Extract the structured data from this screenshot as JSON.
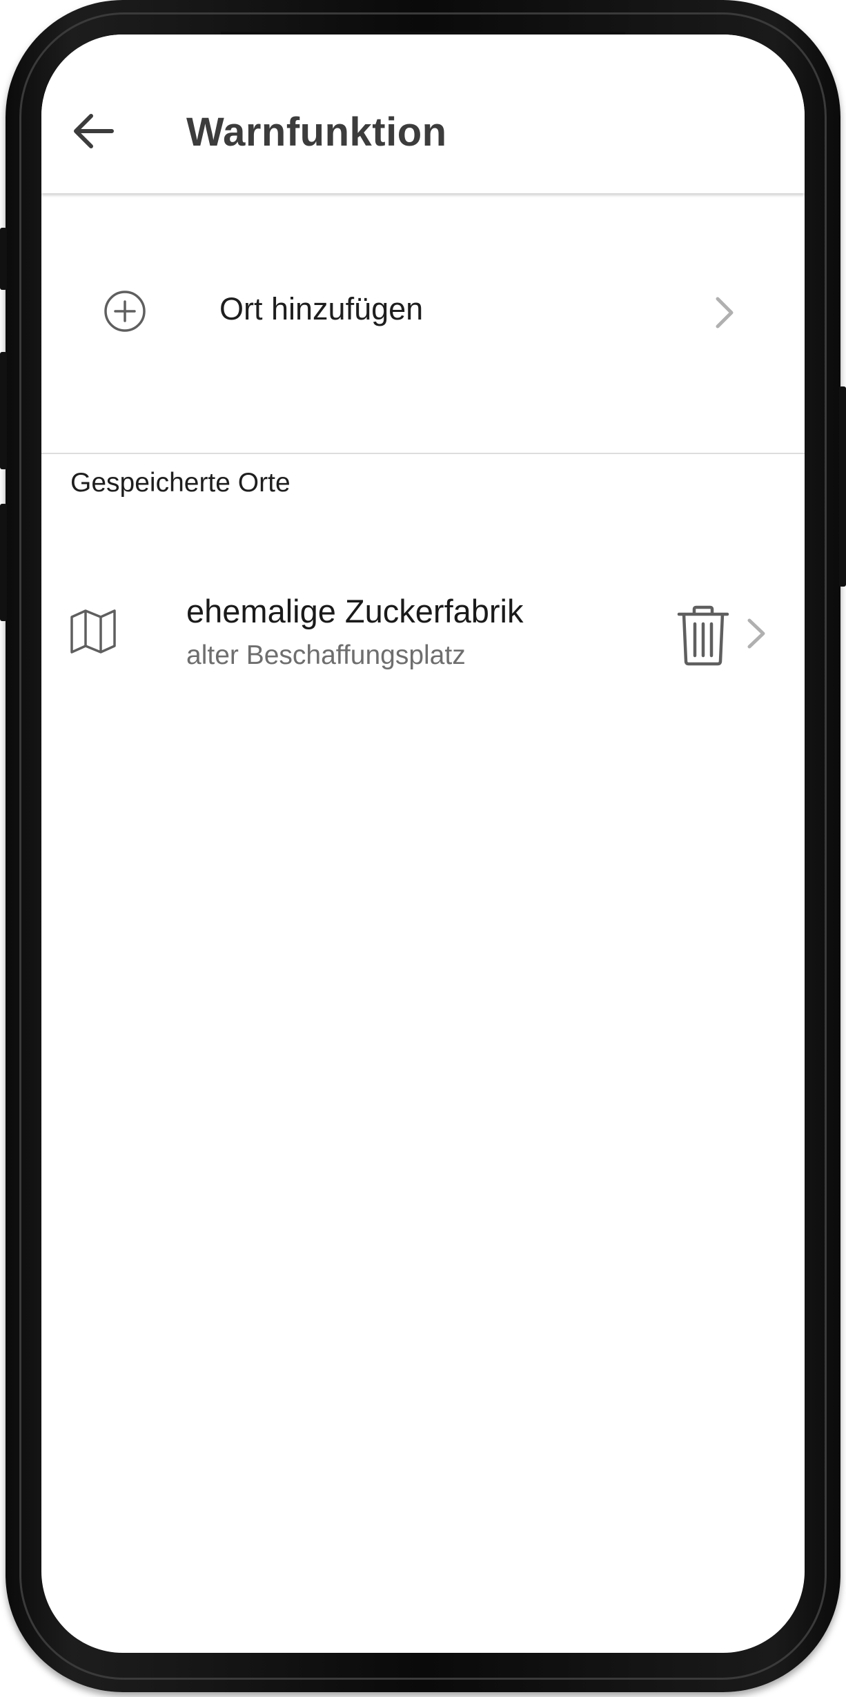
{
  "header": {
    "title": "Warnfunktion",
    "back_icon": "arrow-left-icon"
  },
  "add_place": {
    "label": "Ort hinzufügen",
    "icon": "plus-circle-icon",
    "chevron_icon": "chevron-right-icon"
  },
  "saved_places": {
    "section_title": "Gespeicherte Orte",
    "items": [
      {
        "title": "ehemalige Zuckerfabrik",
        "subtitle": "alter Beschaffungsplatz",
        "icon": "map-icon",
        "delete_icon": "trash-icon",
        "chevron_icon": "chevron-right-icon"
      }
    ]
  },
  "colors": {
    "title_text": "#3c3c3c",
    "primary_text": "#1a1a1a",
    "secondary_text": "#6e6e6e",
    "icon": "#5f5f5f",
    "chevron": "#b0b0b0",
    "divider": "#dddddd",
    "device_frame": "#0b0b0b"
  }
}
